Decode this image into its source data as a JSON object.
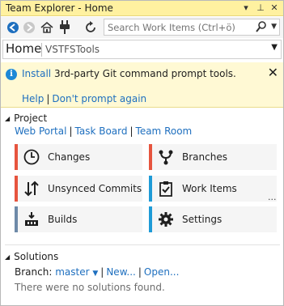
{
  "window": {
    "title": "Team Explorer - Home",
    "buttons": {
      "dropdown": "▾",
      "pin": "⊥",
      "close": "✕"
    }
  },
  "toolbar": {
    "search_placeholder": "Search Work Items (Ctrl+ö)"
  },
  "page": {
    "name": "Home",
    "project": "VSTFSTools"
  },
  "infobar": {
    "link_install": "Install",
    "message": " 3rd-party Git command prompt tools.",
    "help": "Help",
    "dont_prompt": "Don't prompt again"
  },
  "project": {
    "header": "Project",
    "links": [
      "Web Portal",
      "Task Board",
      "Team Room"
    ]
  },
  "tiles": [
    {
      "label": "Changes",
      "icon": "clock-icon",
      "accent": "#e6543e"
    },
    {
      "label": "Branches",
      "icon": "branch-icon",
      "accent": "#e6543e"
    },
    {
      "label": "Unsynced Commits",
      "icon": "sync-arrows-icon",
      "accent": "#e6543e"
    },
    {
      "label": "Work Items",
      "icon": "clipboard-check-icon",
      "accent": "#1e9bd7"
    },
    {
      "label": "Builds",
      "icon": "build-icon",
      "accent": "#6e8aa8"
    },
    {
      "label": "Settings",
      "icon": "gear-icon",
      "accent": "#1e9bd7"
    }
  ],
  "more_label": "...",
  "solutions": {
    "header": "Solutions",
    "branch_label": "Branch:",
    "branch_value": "master",
    "new_label": "New...",
    "open_label": "Open...",
    "empty_text": "There were no solutions found."
  }
}
